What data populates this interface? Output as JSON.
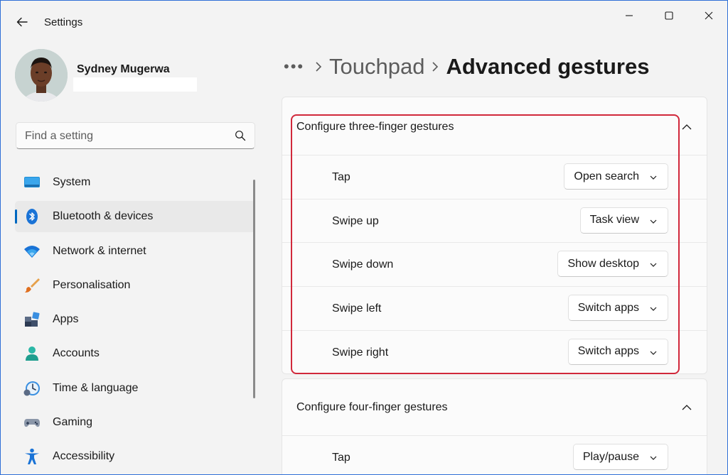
{
  "window": {
    "title": "Settings",
    "controls": [
      "minimize-icon",
      "maximize-icon",
      "close-icon"
    ]
  },
  "profile": {
    "name": "Sydney Mugerwa"
  },
  "search": {
    "placeholder": "Find a setting",
    "icon": "search-icon"
  },
  "sidebar": {
    "selected_index": 1,
    "items": [
      {
        "label": "System",
        "icon": "system-icon"
      },
      {
        "label": "Bluetooth & devices",
        "icon": "bluetooth-icon"
      },
      {
        "label": "Network & internet",
        "icon": "wifi-icon"
      },
      {
        "label": "Personalisation",
        "icon": "brush-icon"
      },
      {
        "label": "Apps",
        "icon": "apps-icon"
      },
      {
        "label": "Accounts",
        "icon": "accounts-icon"
      },
      {
        "label": "Time & language",
        "icon": "time-language-icon"
      },
      {
        "label": "Gaming",
        "icon": "gamepad-icon"
      },
      {
        "label": "Accessibility",
        "icon": "accessibility-icon"
      }
    ]
  },
  "breadcrumb": {
    "more": "•••",
    "parent": "Touchpad",
    "current": "Advanced gestures"
  },
  "three_finger": {
    "title": "Configure three-finger gestures",
    "rows": [
      {
        "label": "Tap",
        "value": "Open search"
      },
      {
        "label": "Swipe up",
        "value": "Task view"
      },
      {
        "label": "Swipe down",
        "value": "Show desktop"
      },
      {
        "label": "Swipe left",
        "value": "Switch apps"
      },
      {
        "label": "Swipe right",
        "value": "Switch apps"
      }
    ]
  },
  "four_finger": {
    "title": "Configure four-finger gestures",
    "rows": [
      {
        "label": "Tap",
        "value": "Play/pause"
      }
    ]
  },
  "colors": {
    "accent": "#0067c0",
    "highlight": "#d1283b"
  }
}
